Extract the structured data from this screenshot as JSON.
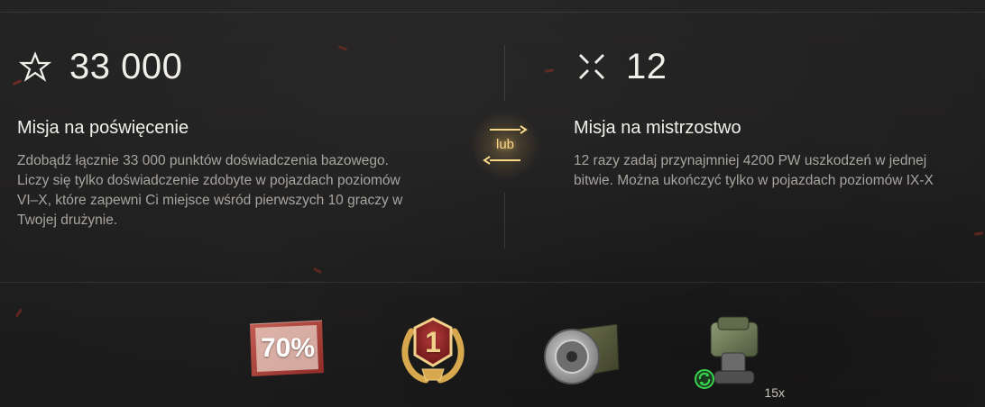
{
  "missions": {
    "left": {
      "icon": "star-outline-icon",
      "value": "33 000",
      "title": "Misja na poświęcenie",
      "description": "Zdobądź łącznie 33 000 punktów doświadczenia bazowego. Liczy się tylko doświadczenie zdobyte w pojazdach poziomów VI–X, które zapewni Ci miejsce wśród pierwszych 10 graczy w Twojej drużynie."
    },
    "right": {
      "icon": "crosshair-icon",
      "value": "12",
      "title": "Misja na mistrzostwo",
      "description_line1": "12 razy zadaj przynajmniej 4200 PW uszkodzeń w jednej",
      "description_line2": "bitwie. Można ukończyć tylko w pojazdach poziomów IX-X"
    }
  },
  "or_indicator": {
    "label": "lub",
    "accent_color": "#f7d788"
  },
  "rewards": [
    {
      "name": "discount-coupon",
      "label": "70%",
      "icon": "coupon-icon"
    },
    {
      "name": "first-place-badge",
      "label": "1",
      "icon": "laurel-badge-icon"
    },
    {
      "name": "equipment-drive",
      "icon": "equipment-icon"
    },
    {
      "name": "consumable-pack",
      "icon": "consumable-icon",
      "count": "15x",
      "refresh_icon": "refresh-icon"
    }
  ],
  "colors": {
    "background": "#1f1e1e",
    "text_primary": "#f1efe9",
    "text_secondary": "#a8a5a0",
    "coupon_red": "#a3322b",
    "badge_gold": "#d7a84d",
    "refresh_green": "#39d34e"
  }
}
